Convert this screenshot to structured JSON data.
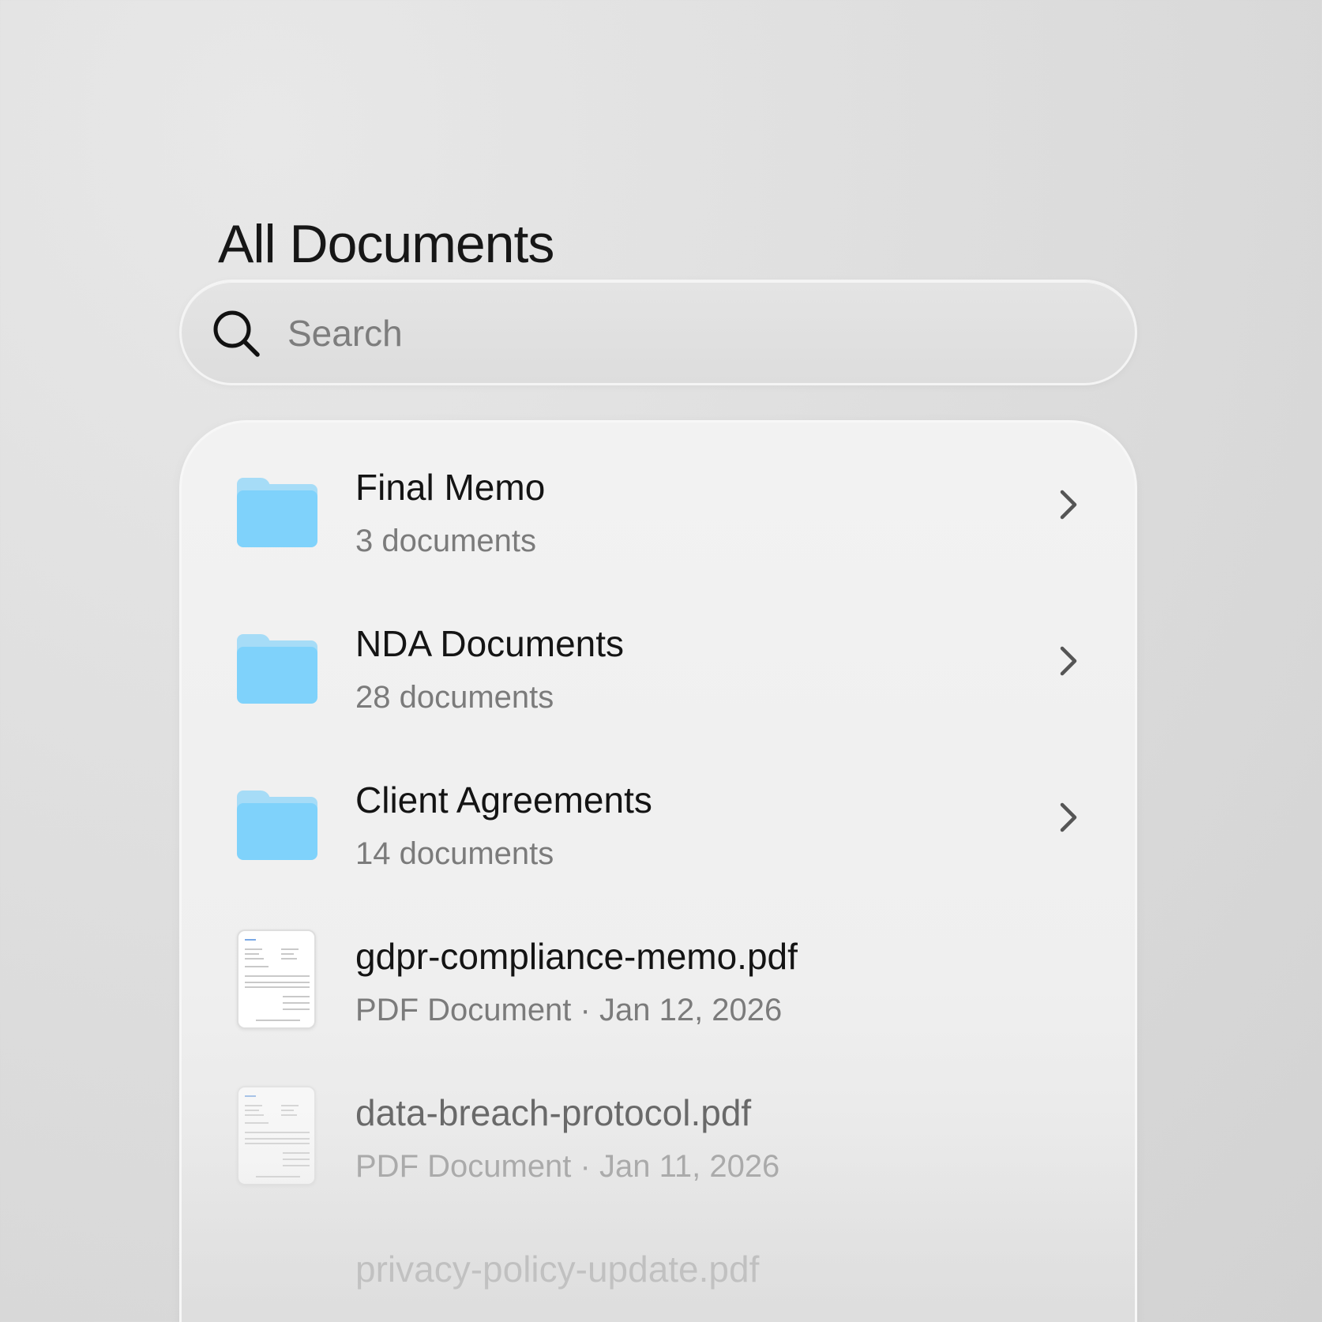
{
  "header": {
    "title": "All Documents"
  },
  "search": {
    "placeholder": "Search",
    "value": "",
    "icon": "search-icon"
  },
  "folders": [
    {
      "name": "Final Memo",
      "count_label": "3 documents",
      "icon": "folder-icon",
      "color": "#7fd2fb"
    },
    {
      "name": "NDA Documents",
      "count_label": "28 documents",
      "icon": "folder-icon",
      "color": "#7fd2fb"
    },
    {
      "name": "Client Agreements",
      "count_label": "14 documents",
      "icon": "folder-icon",
      "color": "#7fd2fb"
    }
  ],
  "files": [
    {
      "name": "gdpr-compliance-memo.pdf",
      "meta": "PDF Document · Jan 12, 2026",
      "icon": "pdf-thumbnail-icon"
    },
    {
      "name": "data-breach-protocol.pdf",
      "meta": "PDF Document · Jan 11, 2026",
      "icon": "pdf-thumbnail-icon"
    },
    {
      "name": "privacy-policy-update.pdf",
      "meta": "",
      "icon": "pdf-thumbnail-icon"
    }
  ],
  "colors": {
    "folder": "#7fd2fb",
    "folder_tab": "#a6dcf7",
    "title_text": "#141414",
    "secondary_text": "#7b7b7b"
  }
}
